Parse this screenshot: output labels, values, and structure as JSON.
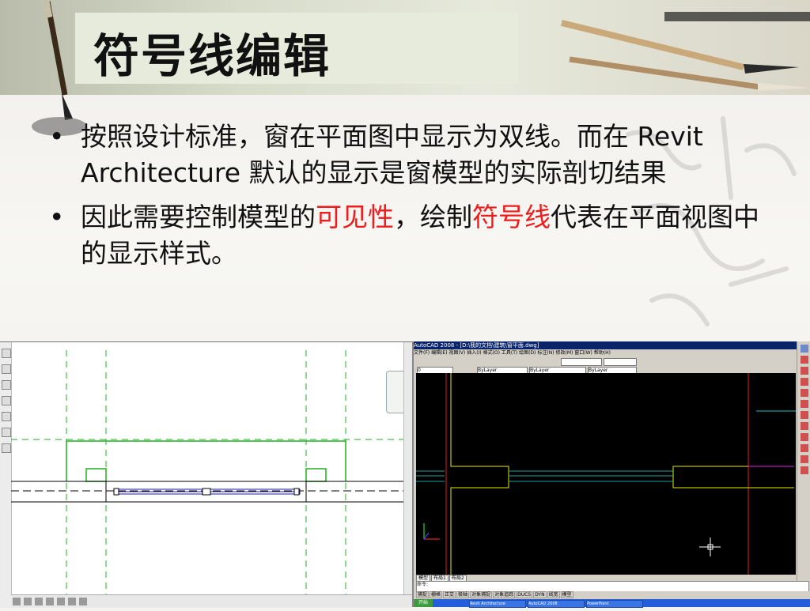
{
  "slide": {
    "title": "符号线编辑",
    "bullets": [
      {
        "parts": [
          {
            "text": "按照设计标准，窗在平面图中显示为双线。而在 Revit Architecture 默认的显示是窗模型的实际剖切结果",
            "highlight": false
          }
        ]
      },
      {
        "parts": [
          {
            "text": "因此需要控制模型的",
            "highlight": false
          },
          {
            "text": "可见性",
            "highlight": true
          },
          {
            "text": "，绘制",
            "highlight": false
          },
          {
            "text": "符号线",
            "highlight": true
          },
          {
            "text": "代表在平面视图中的显示样式。",
            "highlight": false
          }
        ]
      }
    ],
    "bullet_char": "•",
    "highlight_color": "#ee1c1c"
  },
  "revit_view": {
    "cut_line_color": "#1fb21f",
    "window_line_color": "#1a1aa0"
  },
  "autocad": {
    "title_text": "AutoCAD 2008 - [D:\\我的文档\\建筑\\窗平面.dwg]",
    "menu_items": [
      "文件(F)",
      "编辑(E)",
      "视图(V)",
      "插入(I)",
      "格式(O)",
      "工具(T)",
      "绘图(D)",
      "标注(N)",
      "修改(M)",
      "窗口(W)",
      "帮助(H)"
    ],
    "layer_combo": "0",
    "color_combo": "ByLayer",
    "linetype_combo": "ByLayer",
    "lineweight_combo": "ByLayer",
    "layout_tabs": [
      "模型",
      "布局1",
      "布局2"
    ],
    "command_prompt": "命令:",
    "status_buttons": [
      "捕捉",
      "栅格",
      "正交",
      "极轴",
      "对象捕捉",
      "对象追踪",
      "DUCS",
      "DYN",
      "线宽",
      "模型"
    ],
    "taskbar_start": "开始",
    "taskbar_tasks": [
      "Revit Architecture",
      "AutoCAD 2008",
      "PowerPoint"
    ]
  }
}
